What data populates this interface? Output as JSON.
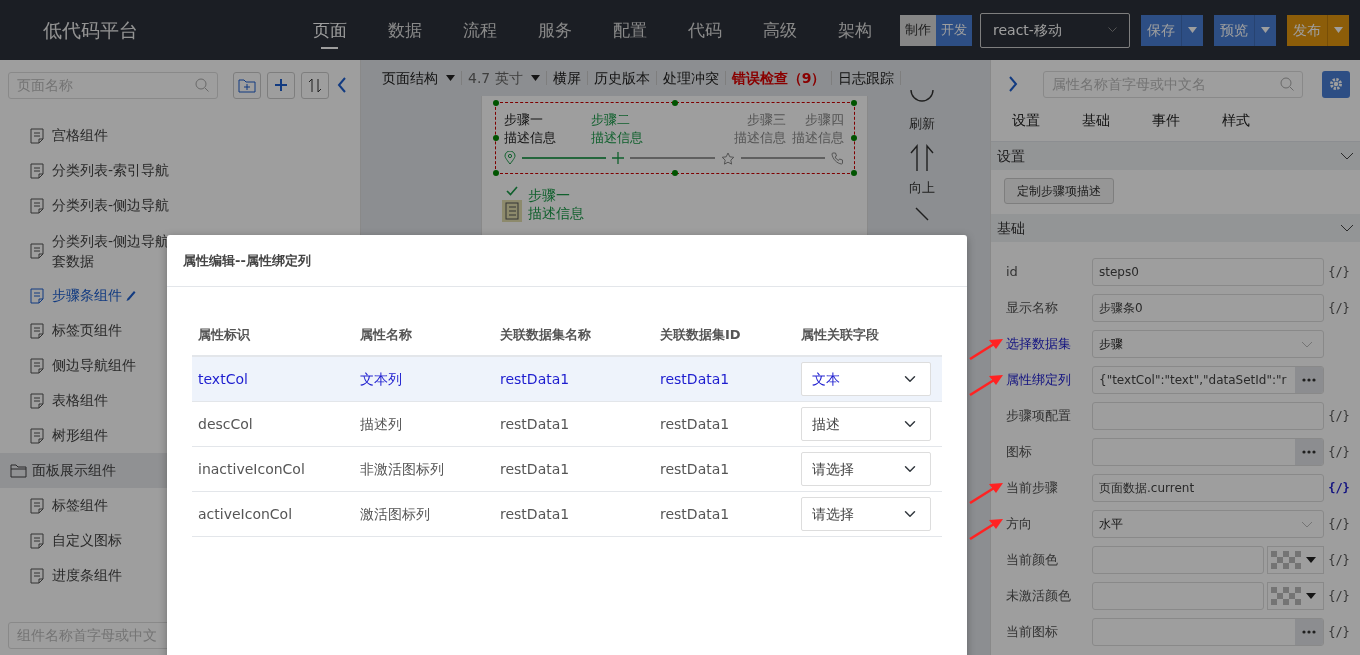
{
  "header": {
    "brand": "低代码平台",
    "nav": [
      {
        "label": "页面",
        "selected": true
      },
      {
        "label": "数据",
        "selected": false
      },
      {
        "label": "流程",
        "selected": false
      },
      {
        "label": "服务",
        "selected": false
      },
      {
        "label": "配置",
        "selected": false
      },
      {
        "label": "代码",
        "selected": false
      },
      {
        "label": "高级",
        "selected": false
      },
      {
        "label": "架构",
        "selected": false
      }
    ],
    "mode_toggle": [
      {
        "label": "制作",
        "selected": false
      },
      {
        "label": "开发",
        "selected": true
      }
    ],
    "platform_select": {
      "value": "react-移动"
    },
    "actions": [
      {
        "label": "保存",
        "kind": "primary"
      },
      {
        "label": "预览",
        "kind": "primary"
      },
      {
        "label": "发布",
        "kind": "warning"
      }
    ]
  },
  "left_sidebar": {
    "search": {
      "placeholder": "页面名称"
    },
    "items": [
      {
        "label": "宫格组件",
        "kind": "file",
        "selected": false
      },
      {
        "label": "分类列表-索引导航",
        "kind": "file",
        "selected": false
      },
      {
        "label": "分类列表-侧边导航",
        "kind": "file",
        "selected": false
      },
      {
        "label": "分类列表-侧边导航套数据",
        "kind": "file",
        "selected": false
      },
      {
        "label": "步骤条组件",
        "kind": "file",
        "selected": true
      },
      {
        "label": "标签页组件",
        "kind": "file",
        "selected": false
      },
      {
        "label": "侧边导航组件",
        "kind": "file",
        "selected": false
      },
      {
        "label": "表格组件",
        "kind": "file",
        "selected": false
      },
      {
        "label": "树形组件",
        "kind": "file",
        "selected": false
      },
      {
        "label": "面板展示组件",
        "kind": "folder",
        "selected": false
      },
      {
        "label": "标签组件",
        "kind": "file",
        "selected": false
      },
      {
        "label": "自定义图标",
        "kind": "file",
        "selected": false
      },
      {
        "label": "进度条组件",
        "kind": "file",
        "selected": false
      }
    ],
    "component_search": {
      "placeholder": "组件名称首字母或中文"
    }
  },
  "canvas": {
    "toolbar": [
      {
        "label": "页面结构",
        "kind": "dropdown"
      },
      {
        "label": "4.7 英寸",
        "kind": "dropdown-muted"
      },
      {
        "label": "横屏",
        "kind": "plain"
      },
      {
        "label": "历史版本",
        "kind": "plain"
      },
      {
        "label": "处理冲突",
        "kind": "plain"
      },
      {
        "label": "错误检查（9）",
        "kind": "error"
      },
      {
        "label": "日志跟踪",
        "kind": "plain"
      }
    ],
    "steps": [
      {
        "title": "步骤一",
        "description": "描述信息",
        "done": true,
        "current": false
      },
      {
        "title": "步骤二",
        "description": "描述信息",
        "done": false,
        "current": true
      },
      {
        "title": "步骤三",
        "description": "描述信息",
        "done": false,
        "current": false
      },
      {
        "title": "步骤四",
        "description": "描述信息",
        "done": false,
        "current": false
      }
    ],
    "vertical_step": {
      "title": "步骤一",
      "description": "描述信息"
    },
    "tools": [
      {
        "label": "刷新",
        "kind": "refresh"
      },
      {
        "label": "向上",
        "kind": "up"
      }
    ]
  },
  "right_panel": {
    "search": {
      "placeholder": "属性名称首字母或中文名"
    },
    "tabs": [
      {
        "label": "设置"
      },
      {
        "label": "基础"
      },
      {
        "label": "事件"
      },
      {
        "label": "样式"
      }
    ],
    "sections": [
      {
        "title": "设置",
        "expanded": true,
        "button": "定制步骤项描述"
      },
      {
        "title": "基础",
        "expanded": true
      }
    ],
    "fields": [
      {
        "label": "id",
        "kind": "text",
        "value": "steps0",
        "highlighted": false,
        "marked": false,
        "tag": "{/}",
        "bound": false
      },
      {
        "label": "显示名称",
        "kind": "text",
        "value": "步骤条0",
        "highlighted": false,
        "marked": false,
        "tag": "{/}",
        "bound": false
      },
      {
        "label": "选择数据集",
        "kind": "select",
        "value": "步骤",
        "highlighted": true,
        "marked": true
      },
      {
        "label": "属性绑定列",
        "kind": "picker",
        "value": "{\"textCol\":\"text\",\"dataSetId\":\"r",
        "highlighted": true,
        "marked": true
      },
      {
        "label": "步骤项配置",
        "kind": "text",
        "highlighted": false,
        "marked": false,
        "tag": "{/}",
        "bound": false
      },
      {
        "label": "图标",
        "kind": "picker",
        "highlighted": false,
        "marked": false,
        "tag": "{/}",
        "bound": false
      },
      {
        "label": "当前步骤",
        "kind": "text",
        "value": "页面数据.current",
        "highlighted": false,
        "marked": true,
        "tag": "{/}",
        "bound": true
      },
      {
        "label": "方向",
        "kind": "select",
        "value": "水平",
        "highlighted": false,
        "marked": true,
        "tag": "{/}",
        "bound": false
      },
      {
        "label": "当前颜色",
        "kind": "color",
        "highlighted": false,
        "marked": false,
        "tag": "{/}",
        "bound": false
      },
      {
        "label": "未激活颜色",
        "kind": "color",
        "highlighted": false,
        "marked": false,
        "tag": "{/}",
        "bound": false
      },
      {
        "label": "当前图标",
        "kind": "picker",
        "highlighted": false,
        "marked": false,
        "tag": "{/}",
        "bound": false
      }
    ]
  },
  "modal": {
    "title": "属性编辑--属性绑定列",
    "columns": [
      "属性标识",
      "属性名称",
      "关联数据集名称",
      "关联数据集ID",
      "属性关联字段"
    ],
    "rows": [
      {
        "cells": [
          "textCol",
          "文本列",
          "restData1",
          "restData1"
        ],
        "field": "文本",
        "selected": true
      },
      {
        "cells": [
          "descCol",
          "描述列",
          "restData1",
          "restData1"
        ],
        "field": "描述",
        "selected": false
      },
      {
        "cells": [
          "inactiveIconCol",
          "非激活图标列",
          "restData1",
          "restData1"
        ],
        "field": "请选择",
        "selected": false
      },
      {
        "cells": [
          "activeIconCol",
          "激活图标列",
          "restData1",
          "restData1"
        ],
        "field": "请选择",
        "selected": false
      }
    ]
  }
}
